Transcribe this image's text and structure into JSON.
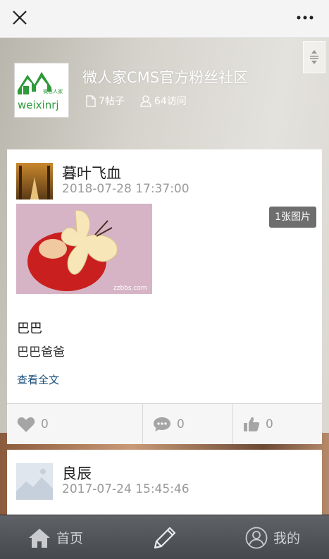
{
  "topbar": {
    "close_icon": "close-icon",
    "more_icon": "more-dots-icon"
  },
  "community": {
    "title": "微人家CMS官方粉丝社区",
    "logo_text": "weixinrj",
    "logo_mini_text": "微信人家",
    "posts_stat": "7帖子",
    "visits_stat": "64访问"
  },
  "posts": [
    {
      "author": "暮叶飞血",
      "time": "2018-07-28 17:37:00",
      "image_badge": "1张图片",
      "image_watermark": "zzbbs.com",
      "title": "巴巴",
      "body": "巴巴爸爸",
      "read_more": "查看全文",
      "likes": "0",
      "comments": "0",
      "thumbs": "0"
    },
    {
      "author": "良辰",
      "time": "2017-07-24 15:45:46"
    }
  ],
  "nav": {
    "home_label": "首页",
    "compose_icon": "pencil-icon",
    "mine_label": "我的"
  },
  "colors": {
    "accent_green": "#2e9a3a",
    "link": "#1a4f7a"
  }
}
